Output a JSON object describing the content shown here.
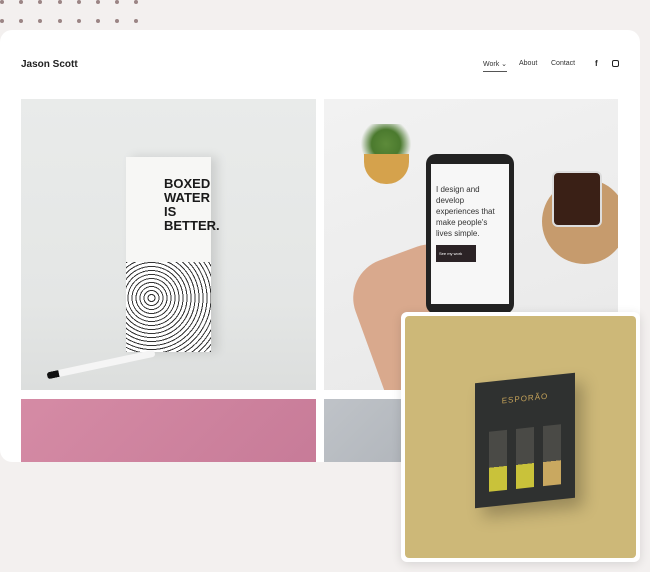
{
  "header": {
    "brand": "Jason Scott",
    "nav": [
      {
        "label": "Work ⌄"
      },
      {
        "label": "About"
      },
      {
        "label": "Contact"
      }
    ],
    "social": [
      "facebook-icon",
      "instagram-icon"
    ]
  },
  "gallery": [
    {
      "subject": "boxed-water-carton",
      "lettering": "BOXED WATER IS BETTER."
    },
    {
      "subject": "phone-website",
      "lettering": "I design and develop experiences that make people's lives simple."
    },
    {
      "subject": "pink-texture"
    },
    {
      "subject": "grey-fabric"
    }
  ],
  "featured": {
    "subject": "esporao-gift-box",
    "lettering": "ESPORÃO"
  },
  "colors": {
    "background": "#f3f0ef",
    "dots": "#9b8585",
    "featured_bg": "#cdb878"
  }
}
